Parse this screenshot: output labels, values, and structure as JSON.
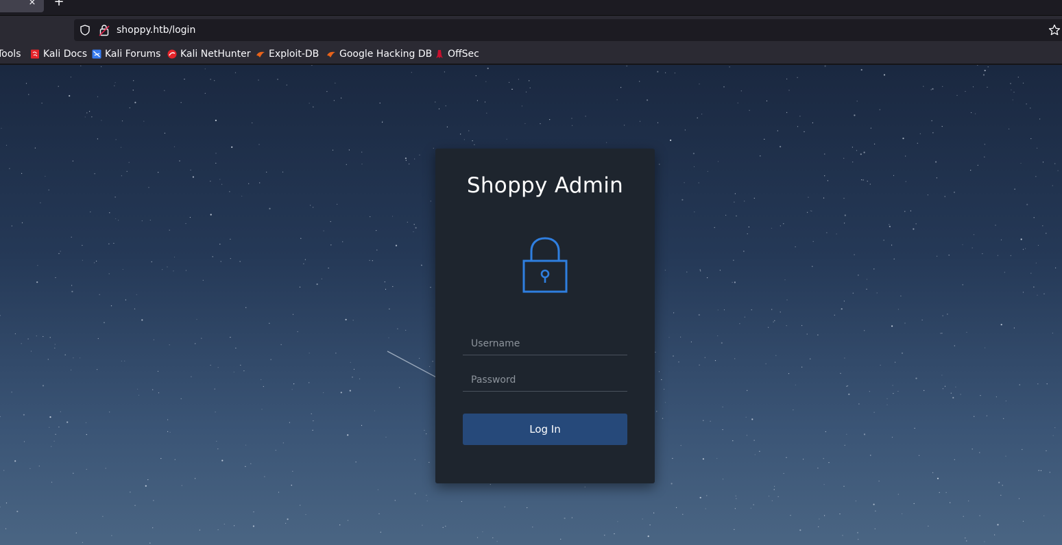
{
  "browser": {
    "tab_close": "×",
    "new_tab": "+",
    "url": "shoppy.htb/login",
    "bookmarks": [
      {
        "label": "Tools",
        "icon": "tools-icon"
      },
      {
        "label": "Kali Docs",
        "icon": "kali-docs-icon",
        "color": "#e5242a"
      },
      {
        "label": "Kali Forums",
        "icon": "kali-forums-icon",
        "color": "#367bf0"
      },
      {
        "label": "Kali NetHunter",
        "icon": "kali-nethunter-icon",
        "color": "#e5242a"
      },
      {
        "label": "Exploit-DB",
        "icon": "exploit-db-icon",
        "color": "#e8631a"
      },
      {
        "label": "Google Hacking DB",
        "icon": "ghdb-icon",
        "color": "#e8631a"
      },
      {
        "label": "OffSec",
        "icon": "offsec-icon",
        "color": "#c8102e"
      }
    ]
  },
  "login": {
    "title": "Shoppy Admin",
    "username_placeholder": "Username",
    "password_placeholder": "Password",
    "submit_label": "Log In",
    "accent": "#2f7fe0",
    "button_color": "#26497a"
  }
}
